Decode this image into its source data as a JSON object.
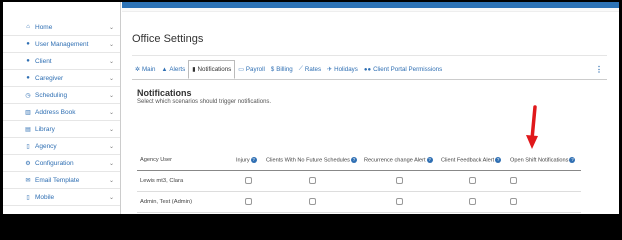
{
  "sidebar": {
    "items": [
      {
        "icon": "home-icon",
        "glyph": "⌂",
        "label": "Home"
      },
      {
        "icon": "user-icon",
        "glyph": "●",
        "label": "User Management"
      },
      {
        "icon": "user-icon",
        "glyph": "●",
        "label": "Client"
      },
      {
        "icon": "user-icon",
        "glyph": "●",
        "label": "Caregiver"
      },
      {
        "icon": "clock-icon",
        "glyph": "◷",
        "label": "Scheduling"
      },
      {
        "icon": "book-icon",
        "glyph": "▥",
        "label": "Address Book"
      },
      {
        "icon": "library-icon",
        "glyph": "▤",
        "label": "Library"
      },
      {
        "icon": "document-icon",
        "glyph": "▯",
        "label": "Agency"
      },
      {
        "icon": "gears-icon",
        "glyph": "⚙",
        "label": "Configuration"
      },
      {
        "icon": "envelope-icon",
        "glyph": "✉",
        "label": "Email Template"
      },
      {
        "icon": "mobile-icon",
        "glyph": "▯",
        "label": "Mobile"
      }
    ],
    "chevron": "⌄"
  },
  "page": {
    "title": "Office Settings",
    "kebab": "⋮"
  },
  "tabs": [
    {
      "icon": "gear-icon",
      "glyph": "✲",
      "label": "Main"
    },
    {
      "icon": "bell-icon",
      "glyph": "▲",
      "label": "Alerts"
    },
    {
      "icon": "file-icon",
      "glyph": "▮",
      "label": "Notifications",
      "active": true
    },
    {
      "icon": "payroll-icon",
      "glyph": "▭",
      "label": "Payroll"
    },
    {
      "icon": "dollar-icon",
      "glyph": "$",
      "label": "Billing"
    },
    {
      "icon": "chart-icon",
      "glyph": "⟋",
      "label": "Rates"
    },
    {
      "icon": "plane-icon",
      "glyph": "✈",
      "label": "Holidays"
    },
    {
      "icon": "users-icon",
      "glyph": "●●",
      "label": "Client Portal Permissions"
    }
  ],
  "section": {
    "title": "Notifications",
    "subtitle": "Select which scenarios should trigger notifications."
  },
  "table": {
    "columns": [
      {
        "label": "Agency User",
        "help": false
      },
      {
        "label": "Injury",
        "help": true
      },
      {
        "label": "Clients With No Future Schedules",
        "help": true
      },
      {
        "label": "Recurrence change Alert",
        "help": true
      },
      {
        "label": "Client Feedback Alert",
        "help": true
      },
      {
        "label": "Open Shift Notifications",
        "help": true
      }
    ],
    "help_glyph": "?",
    "rows": [
      {
        "name": "Lewis mt3, Clara",
        "checks": [
          false,
          false,
          false,
          false,
          false
        ]
      },
      {
        "name": "Admin, Test (Admin)",
        "checks": [
          false,
          false,
          false,
          false,
          false
        ]
      }
    ]
  },
  "colors": {
    "accent": "#2f6fb3",
    "arrow": "#e0181b"
  }
}
